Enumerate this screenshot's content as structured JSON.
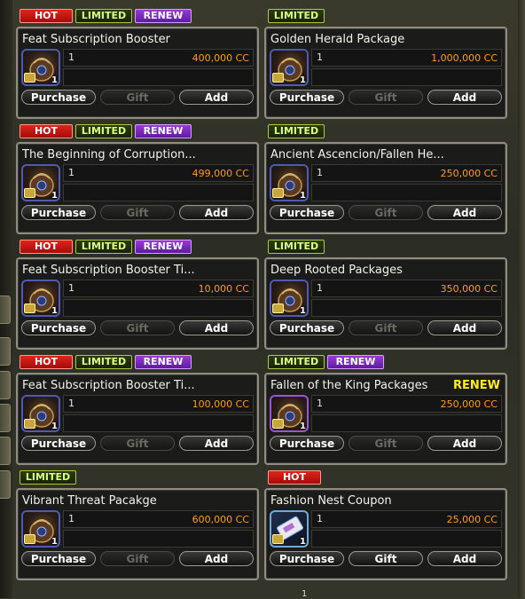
{
  "cards": [
    {
      "tags": [
        "HOT",
        "LIMITED",
        "RENEW"
      ],
      "title": "Feat Subscription Booster",
      "accent": "",
      "count": "1",
      "price": "400,000 CC",
      "qty": "1",
      "icon": "bag",
      "buttons": [
        "Purchase",
        "Gift",
        "Add"
      ],
      "gift_enabled": false
    },
    {
      "tags": [
        "LIMITED"
      ],
      "title": "Golden Herald Package",
      "accent": "",
      "count": "1",
      "price": "1,000,000 CC",
      "qty": "1",
      "icon": "bag",
      "buttons": [
        "Purchase",
        "Gift",
        "Add"
      ],
      "gift_enabled": false
    },
    {
      "tags": [
        "HOT",
        "LIMITED",
        "RENEW"
      ],
      "title": "The Beginning of Corruption...",
      "accent": "",
      "count": "1",
      "price": "499,000 CC",
      "qty": "1",
      "icon": "bag",
      "buttons": [
        "Purchase",
        "Gift",
        "Add"
      ],
      "gift_enabled": false
    },
    {
      "tags": [
        "LIMITED"
      ],
      "title": "Ancient Ascencion/Fallen He...",
      "accent": "",
      "count": "1",
      "price": "250,000 CC",
      "qty": "1",
      "icon": "bag",
      "buttons": [
        "Purchase",
        "Gift",
        "Add"
      ],
      "gift_enabled": false
    },
    {
      "tags": [
        "HOT",
        "LIMITED",
        "RENEW"
      ],
      "title": "Feat Subscription Booster Ti...",
      "accent": "",
      "count": "1",
      "price": "10,000 CC",
      "qty": "1",
      "icon": "bag",
      "buttons": [
        "Purchase",
        "Gift",
        "Add"
      ],
      "gift_enabled": false
    },
    {
      "tags": [
        "LIMITED"
      ],
      "title": "Deep Rooted Packages",
      "accent": "",
      "count": "1",
      "price": "350,000 CC",
      "qty": "1",
      "icon": "bag",
      "buttons": [
        "Purchase",
        "Gift",
        "Add"
      ],
      "gift_enabled": false
    },
    {
      "tags": [
        "HOT",
        "LIMITED",
        "RENEW"
      ],
      "title": "Feat Subscription Booster Ti...",
      "accent": "",
      "count": "1",
      "price": "100,000 CC",
      "qty": "1",
      "icon": "bag",
      "buttons": [
        "Purchase",
        "Gift",
        "Add"
      ],
      "gift_enabled": false
    },
    {
      "tags": [
        "LIMITED",
        "RENEW"
      ],
      "title": "Fallen of the King Packages",
      "accent": "RENEW",
      "count": "1",
      "price": "250,000 CC",
      "qty": "1",
      "icon": "bag-purple",
      "buttons": [
        "Purchase",
        "Gift",
        "Add"
      ],
      "gift_enabled": false
    },
    {
      "tags": [
        "LIMITED"
      ],
      "title": "Vibrant Threat Pacakge",
      "accent": "",
      "count": "1",
      "price": "600,000 CC",
      "qty": "1",
      "icon": "bag",
      "buttons": [
        "Purchase",
        "Gift",
        "Add"
      ],
      "gift_enabled": false
    },
    {
      "tags": [
        "HOT"
      ],
      "title": "Fashion Nest Coupon",
      "accent": "",
      "count": "1",
      "price": "25,000 CC",
      "qty": "1",
      "icon": "coupon",
      "buttons": [
        "Purchase",
        "Gift",
        "Add"
      ],
      "gift_enabled": true
    }
  ],
  "pager": {
    "page": "1"
  },
  "colors": {
    "hot": "#e0231b",
    "limited": "#a8cc3a",
    "renew": "#9a3ad6",
    "price": "#ff9c1a",
    "accent": "#ffee18"
  }
}
